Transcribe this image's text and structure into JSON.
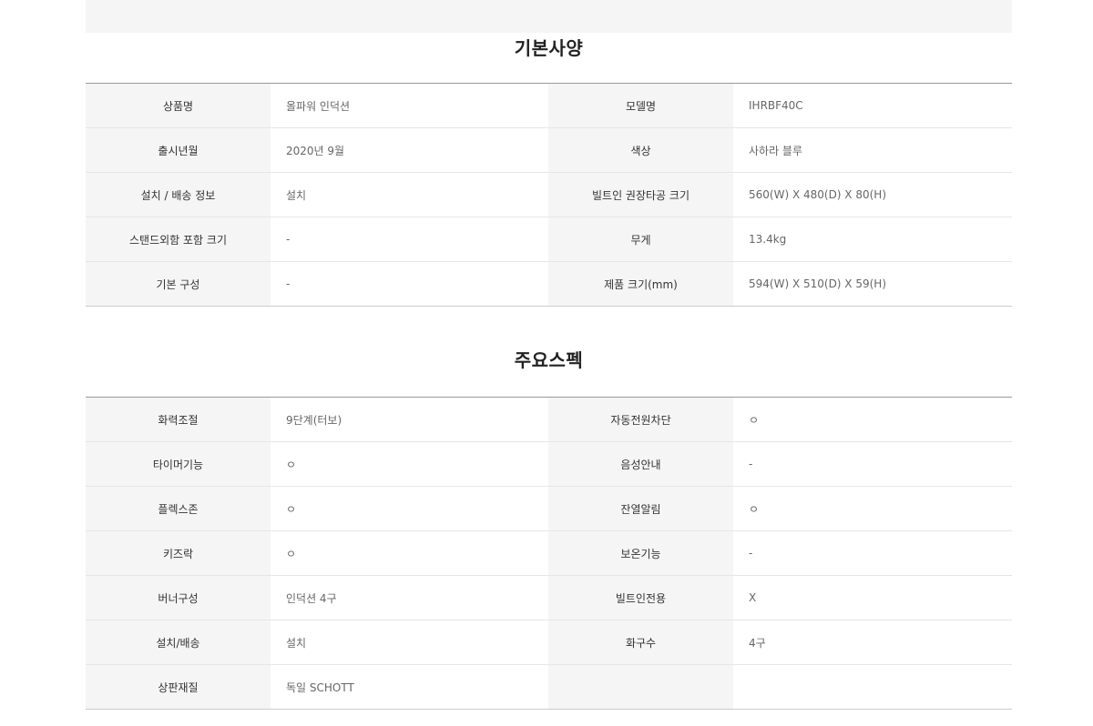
{
  "basic_spec": {
    "title": "기본사양",
    "rows": [
      {
        "label1": "상품명",
        "value1": "올파워 인덕션",
        "label2": "모델명",
        "value2": "IHRBF40C"
      },
      {
        "label1": "출시년월",
        "value1": "2020년 9월",
        "label2": "색상",
        "value2": "사하라 블루"
      },
      {
        "label1": "설치 / 배송 정보",
        "value1": "설치",
        "label2": "빌트인 권장타공 크기",
        "value2": "560(W) X 480(D) X 80(H)"
      },
      {
        "label1": "스탠드외함 포함 크기",
        "value1": "-",
        "label2": "무게",
        "value2": "13.4kg"
      },
      {
        "label1": "기본 구성",
        "value1": "-",
        "label2": "제품 크기(mm)",
        "value2": "594(W) X 510(D) X 59(H)"
      }
    ]
  },
  "main_spec": {
    "title": "주요스펙",
    "rows": [
      {
        "label1": "화력조절",
        "value1": "9단계(터보)",
        "label2": "자동전원차단",
        "value2": "ㅇ"
      },
      {
        "label1": "타이머기능",
        "value1": "ㅇ",
        "label2": "음성안내",
        "value2": "-"
      },
      {
        "label1": "플렉스존",
        "value1": "ㅇ",
        "label2": "잔열알림",
        "value2": "ㅇ"
      },
      {
        "label1": "키즈락",
        "value1": "ㅇ",
        "label2": "보온기능",
        "value2": "-"
      },
      {
        "label1": "버너구성",
        "value1": "인덕션 4구",
        "label2": "빌트인전용",
        "value2": "X"
      },
      {
        "label1": "설치/배송",
        "value1": "설치",
        "label2": "화구수",
        "value2": "4구"
      },
      {
        "label1": "상판재질",
        "value1": "독일 SCHOTT",
        "label2": "",
        "value2": ""
      }
    ]
  }
}
